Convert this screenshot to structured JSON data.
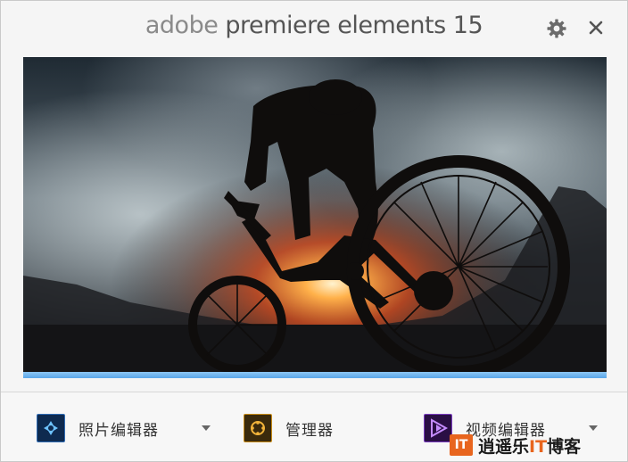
{
  "window": {
    "title_brand": "adobe",
    "title_product": "premiere elements 15"
  },
  "icons": {
    "settings": "gear-icon",
    "close": "close-icon"
  },
  "splash": {
    "image": "mountain-biker-silhouette-at-sunset",
    "progress_percent": 100
  },
  "apps": [
    {
      "label": "照片编辑器",
      "icon": "photo-editor-icon",
      "has_dropdown": true,
      "icon_color": "#1c4e8a"
    },
    {
      "label": "管理器",
      "icon": "organizer-icon",
      "has_dropdown": false,
      "icon_color": "#e8a21c"
    },
    {
      "label": "视频编辑器",
      "icon": "video-editor-icon",
      "has_dropdown": true,
      "icon_color": "#8a3cc8"
    }
  ],
  "watermark": {
    "logo_text": "IT",
    "text_before": "逍遥乐",
    "text_it": "IT",
    "text_after": "博客"
  },
  "colors": {
    "progress": "#5aa8ea",
    "watermark_accent": "#e8651e"
  }
}
